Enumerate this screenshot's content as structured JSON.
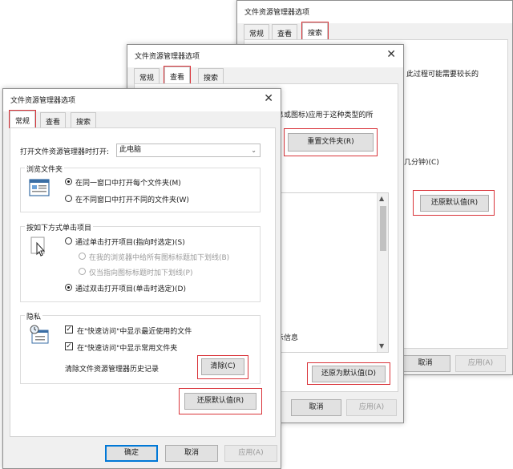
{
  "back_dialog": {
    "title": "文件资源管理器选项",
    "tabs": [
      "常规",
      "查看",
      "搜索"
    ],
    "partial_text": "此过程可能需要较长的",
    "partial_text2": "几分钟)(C)",
    "restore_button": "还原默认值(R)",
    "cancel_button": "取消",
    "apply_button": "应用(A)"
  },
  "middle_dialog": {
    "title": "文件资源管理器选项",
    "tabs": [
      "常规",
      "查看",
      "搜索"
    ],
    "partial_text": "息或图标)应用于这种类型的所",
    "reset_folders_button": "重置文件夹(R)",
    "partial_list_text": "示信息",
    "restore_defaults_button": "还原为默认值(D)",
    "cancel_button": "取消",
    "apply_button": "应用(A)"
  },
  "front_dialog": {
    "title": "文件资源管理器选项",
    "tabs": [
      "常规",
      "查看",
      "搜索"
    ],
    "open_label": "打开文件资源管理器时打开:",
    "open_value": "此电脑",
    "browse_group": {
      "title": "浏览文件夹",
      "option1": "在同一窗口中打开每个文件夹(M)",
      "option2": "在不同窗口中打开不同的文件夹(W)"
    },
    "click_group": {
      "title": "按如下方式单击项目",
      "option1": "通过单击打开项目(指向时选定)(S)",
      "sub1": "在我的浏览器中给所有图标标题加下划线(B)",
      "sub2": "仅当指向图标标题时加下划线(P)",
      "option2": "通过双击打开项目(单击时选定)(D)"
    },
    "privacy_group": {
      "title": "隐私",
      "check1": "在\"快速访问\"中显示最近使用的文件",
      "check2": "在\"快速访问\"中显示常用文件夹",
      "clear_label": "清除文件资源管理器历史记录",
      "clear_button": "清除(C)"
    },
    "restore_button": "还原默认值(R)",
    "ok_button": "确定",
    "cancel_button": "取消",
    "apply_button": "应用(A)"
  },
  "colors": {
    "highlight": "#d9343a",
    "accent": "#0078d7"
  }
}
